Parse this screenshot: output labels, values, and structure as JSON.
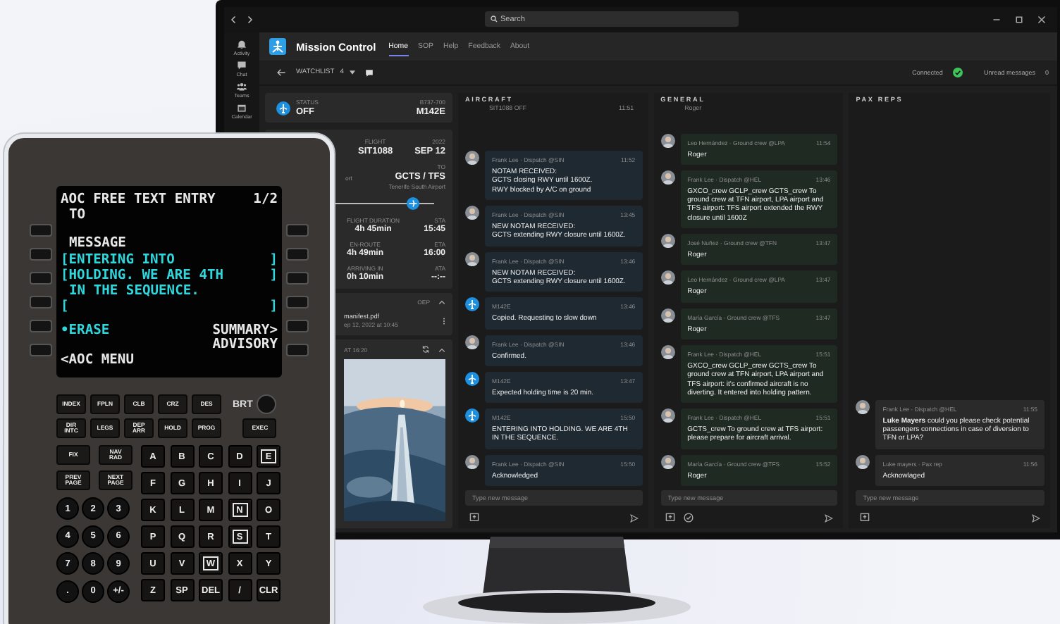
{
  "window": {
    "search": {
      "placeholder": "Search"
    }
  },
  "rail": [
    {
      "kind": "activity",
      "label": "Activity"
    },
    {
      "kind": "chat",
      "label": "Chat"
    },
    {
      "kind": "teams",
      "label": "Teams"
    },
    {
      "kind": "calendar",
      "label": "Calendar"
    }
  ],
  "app": {
    "name": "Mission Control",
    "tabs": [
      {
        "label": "Home",
        "selected": true
      },
      {
        "label": "SOP",
        "selected": false
      },
      {
        "label": "Help",
        "selected": false
      },
      {
        "label": "Feedback",
        "selected": false
      },
      {
        "label": "About",
        "selected": false
      }
    ]
  },
  "toolbar": {
    "watchlist": "WATCHLIST",
    "watchlist_count": "4",
    "connection": "Connected",
    "connected": true,
    "unread_label": "Unread messages",
    "unread_count": "0"
  },
  "flight": {
    "status_label": "STATUS",
    "status": "OFF",
    "aircraft_type": "B737-700",
    "registration": "M142E",
    "flight_label": "FLIGHT",
    "flight_number": "SIT1088",
    "year": "2022",
    "date": "SEP 12",
    "origin_fragment": "ort",
    "to_label": "TO",
    "route": "GCTS / TFS",
    "destination": "Tenerife South Airport",
    "progress": {
      "level": 0.78
    },
    "stats": [
      {
        "label": "FLIGHT DURATION",
        "value": "4h 45min",
        "time_label": "STA",
        "time": "15:45"
      },
      {
        "label": "EN-ROUTE",
        "value": "4h 49min",
        "time_label": "ETA",
        "time": "16:00"
      },
      {
        "label": "ARRIVING IN",
        "value": "0h 10min",
        "time_label": "ATA",
        "time": "--:--"
      }
    ]
  },
  "documents": {
    "header": "OEP",
    "file": "manifest.pdf",
    "date": "ep 12, 2022 at 10:45"
  },
  "photo": {
    "header": "AT 16:20",
    "kind": "picture"
  },
  "columns": [
    {
      "title": "AIRCRAFT",
      "color": "#1e2932",
      "check_action": false,
      "placeholder": "Type new message",
      "fragment": [
        "SIT1088 OFF",
        "11:51"
      ],
      "messages": [
        {
          "kind": "person",
          "author": "Frank Lee  ·  Dispatch @SIN",
          "time": "11:52",
          "text": "NOTAM RECEIVED:\nGCTS closing RWY until 1600Z.\nRWY blocked by A/C on ground"
        },
        {
          "kind": "person",
          "author": "Frank Lee  ·  Dispatch @SIN",
          "time": "13:45",
          "text": "NEW NOTAM RECEIVED:\nGCTS extending RWY closure until 1600Z."
        },
        {
          "kind": "person",
          "author": "Frank Lee  ·  Dispatch @SIN",
          "time": "13:46",
          "text": "NEW NOTAM RECEIVED:\nGCTS extending RWY closure until 1600Z."
        },
        {
          "kind": "aircraft",
          "author": "M142E",
          "time": "13:46",
          "text": "Copied. Requesting to slow down"
        },
        {
          "kind": "person",
          "author": "Frank Lee  ·  Dispatch @SIN",
          "time": "13:46",
          "text": "Confirmed."
        },
        {
          "kind": "aircraft",
          "author": "M142E",
          "time": "13:47",
          "text": "Expected holding time is 20 min."
        },
        {
          "kind": "aircraft",
          "author": "M142E",
          "time": "15:50",
          "text": "ENTERING INTO HOLDING. WE ARE 4TH IN THE SEQUENCE."
        },
        {
          "kind": "person",
          "author": "Frank Lee  ·  Dispatch @SIN",
          "time": "15:50",
          "text": "Acknowledged"
        }
      ]
    },
    {
      "title": "GENERAL",
      "color": "#1f2b22",
      "check_action": true,
      "placeholder": "Type new message",
      "fragment": [
        "Roger"
      ],
      "messages": [
        {
          "kind": "person",
          "author": "Leo Hernández  ·  Ground crew @LPA",
          "time": "11:54",
          "text": "Roger"
        },
        {
          "kind": "person",
          "author": "Frank Lee  ·  Dispatch @HEL",
          "time": "13:46",
          "text": "GXCO_crew GCLP_crew GCTS_crew To ground crew at TFN airport, LPA airport and TFS airport: TFS airport extended the RWY closure until 1600Z"
        },
        {
          "kind": "person",
          "author": "José Nuñez  ·  Ground crew @TFN",
          "time": "13:47",
          "text": "Roger"
        },
        {
          "kind": "person",
          "author": "Leo Hernández  ·  Ground crew @LPA",
          "time": "13:47",
          "text": "Roger"
        },
        {
          "kind": "person",
          "author": "María García  ·  Ground crew @TFS",
          "time": "13:47",
          "text": "Roger"
        },
        {
          "kind": "person",
          "author": "Frank Lee  ·  Dispatch @HEL",
          "time": "15:51",
          "text": "GXCO_crew GCLP_crew GCTS_crew To ground crew at TFN airport, LPA airport and TFS airport: it's confirmed aircraft is no diverting. It entered into holding pattern."
        },
        {
          "kind": "person",
          "author": "Frank Lee  ·  Dispatch @HEL",
          "time": "15:51",
          "text": "GCTS_crew To ground crew at TFS airport: please prepare for aircraft arrival."
        },
        {
          "kind": "person",
          "author": "María García  ·  Ground crew @TFS",
          "time": "15:52",
          "text": "Roger"
        }
      ]
    },
    {
      "title": "PAX REPS",
      "color": "#2a2a2a",
      "check_action": false,
      "placeholder": "Type new message",
      "messages": [
        {
          "kind": "person",
          "author": "Frank Lee  ·  Dispatch @HEL",
          "time": "11:55",
          "text": "**Luke Mayers** could you please check potential passengers connections in case of diversion to TFN or LPA?"
        },
        {
          "kind": "person",
          "author": "Luke mayers  ·  Pax rep",
          "time": "11:56",
          "text": "Acknowlaged"
        }
      ]
    }
  ],
  "cdu": {
    "lines": [
      {
        "left": "AOC FREE TEXT ENTRY",
        "left_highlighted": false,
        "indent": false,
        "right": "1/2",
        "right_highlighted": false
      },
      {
        "left": "TO",
        "left_highlighted": false,
        "indent": true
      },
      {
        "left": "MESSAGE",
        "left_highlighted": false,
        "indent": true
      },
      {
        "left": "[ENTERING INTO",
        "left_highlighted": true,
        "indent": false,
        "right": "]",
        "right_highlighted": true
      },
      {
        "left": "[HOLDING. WE ARE 4TH",
        "left_highlighted": true,
        "indent": false,
        "right": "]",
        "right_highlighted": true
      },
      {
        "left": "IN THE SEQUENCE.",
        "left_highlighted": true,
        "indent": true
      },
      {
        "left": "[",
        "left_highlighted": true,
        "indent": false,
        "right": "]",
        "right_highlighted": true
      },
      {
        "left": "•ERASE",
        "left_highlighted": true,
        "indent": false,
        "right": "SUMMARY>",
        "right_highlighted": false
      },
      {
        "right": "ADVISORY",
        "right_highlighted": false
      },
      {
        "left": "<AOC MENU",
        "left_highlighted": false,
        "indent": false
      }
    ],
    "function_keys": [
      "INDEX",
      "FPLN",
      "CLB",
      "CRZ",
      "DES",
      "DIR\nINTC",
      "LEGS",
      "DEP\nARR",
      "HOLD",
      "PROG"
    ],
    "brightness": "BRT",
    "exec": "EXEC",
    "side_keys": [
      "FIX",
      "NAV\nRAD",
      "PREV\nPAGE",
      "NEXT\nPAGE"
    ],
    "number_keys": [
      "1",
      "2",
      "3",
      "4",
      "5",
      "6",
      "7",
      "8",
      "9",
      ".",
      "0",
      "+/-"
    ],
    "letter_keys": [
      {
        "label": "A",
        "selected": false
      },
      {
        "label": "B",
        "selected": false
      },
      {
        "label": "C",
        "selected": false
      },
      {
        "label": "D",
        "selected": false
      },
      {
        "label": "E",
        "selected": true
      },
      {
        "label": "F",
        "selected": false
      },
      {
        "label": "G",
        "selected": false
      },
      {
        "label": "H",
        "selected": false
      },
      {
        "label": "I",
        "selected": false
      },
      {
        "label": "J",
        "selected": false
      },
      {
        "label": "K",
        "selected": false
      },
      {
        "label": "L",
        "selected": false
      },
      {
        "label": "M",
        "selected": false
      },
      {
        "label": "N",
        "selected": true
      },
      {
        "label": "O",
        "selected": false
      },
      {
        "label": "P",
        "selected": false
      },
      {
        "label": "Q",
        "selected": false
      },
      {
        "label": "R",
        "selected": false
      },
      {
        "label": "S",
        "selected": true
      },
      {
        "label": "T",
        "selected": false
      },
      {
        "label": "U",
        "selected": false
      },
      {
        "label": "V",
        "selected": false
      },
      {
        "label": "W",
        "selected": true
      },
      {
        "label": "X",
        "selected": false
      },
      {
        "label": "Y",
        "selected": false
      },
      {
        "label": "Z",
        "selected": false
      },
      {
        "label": "SP",
        "selected": false
      },
      {
        "label": "DEL",
        "selected": false
      },
      {
        "label": "/",
        "selected": false
      },
      {
        "label": "CLR",
        "selected": false
      }
    ]
  }
}
